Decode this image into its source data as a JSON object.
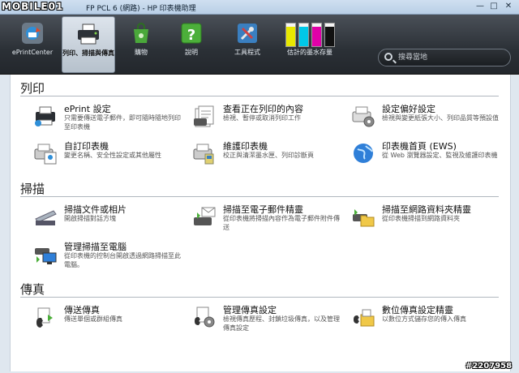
{
  "window": {
    "title": "FP PCL 6 (網路) - HP 印表機助理",
    "watermark_logo": "MOBILE01",
    "watermark_id": "#2207958"
  },
  "ribbon": {
    "tabs": [
      {
        "label": "ePrintCenter",
        "icon": "eprintcenter-icon"
      },
      {
        "label": "列印、掃描與傳真",
        "icon": "printer-icon",
        "selected": true
      },
      {
        "label": "購物",
        "icon": "shopping-bag-icon"
      },
      {
        "label": "說明",
        "icon": "help-icon"
      },
      {
        "label": "工具程式",
        "icon": "tools-icon"
      },
      {
        "label": "估計的墨水存量",
        "icon": "ink-levels-icon"
      }
    ],
    "ink_levels": [
      {
        "color": "#e8e800",
        "level": 0.85
      },
      {
        "color": "#00c8e8",
        "level": 0.85
      },
      {
        "color": "#e000a8",
        "level": 0.85
      },
      {
        "color": "#111111",
        "level": 0.85
      }
    ],
    "search": {
      "placeholder": "搜尋當地"
    }
  },
  "sections": {
    "print": {
      "title": "列印",
      "items": [
        {
          "title": "ePrint 設定",
          "desc": "只需要傳送電子郵件，即可隨時隨地列印至印表機",
          "icon": "eprint-printer-icon"
        },
        {
          "title": "查看正在列印的內容",
          "desc": "檢視、暫停或取消列印工作",
          "icon": "print-queue-icon"
        },
        {
          "title": "設定偏好設定",
          "desc": "檢視與變更紙張大小、列印品質等預設值",
          "icon": "preferences-gear-icon"
        },
        {
          "title": "自訂印表機",
          "desc": "變更名稱、安全性設定或其他屬性",
          "icon": "customize-printer-icon"
        },
        {
          "title": "維護印表機",
          "desc": "校正與清潔墨水匣、列印診斷頁",
          "icon": "maintain-printer-icon"
        },
        {
          "title": "印表機首頁 (EWS)",
          "desc": "從 Web 瀏覽器設定、監視及維護印表機",
          "icon": "globe-icon"
        }
      ]
    },
    "scan": {
      "title": "掃描",
      "items": [
        {
          "title": "掃描文件或相片",
          "desc": "開啟掃描對話方塊",
          "icon": "scanner-icon"
        },
        {
          "title": "掃描至電子郵件精靈",
          "desc": "從印表機將掃描內容作為電子郵件附件傳送",
          "icon": "scan-email-icon"
        },
        {
          "title": "掃描至網路資料夾精靈",
          "desc": "從印表機掃描到網路資料夾",
          "icon": "scan-folder-icon"
        },
        {
          "title": "管理掃描至電腦",
          "desc": "從印表機的控制台開啟透過網路掃描至此電腦。",
          "icon": "scan-computer-icon"
        }
      ]
    },
    "fax": {
      "title": "傳真",
      "items": [
        {
          "title": "傳送傳真",
          "desc": "傳送單個或群組傳真",
          "icon": "fax-phone-icon"
        },
        {
          "title": "管理傳真設定",
          "desc": "檢視傳真歷程、封鎖垃圾傳真，以及管理傳真設定",
          "icon": "fax-settings-icon"
        },
        {
          "title": "數位傳真設定精靈",
          "desc": "以數位方式儲存您的傳入傳真",
          "icon": "digital-fax-icon"
        }
      ]
    }
  }
}
